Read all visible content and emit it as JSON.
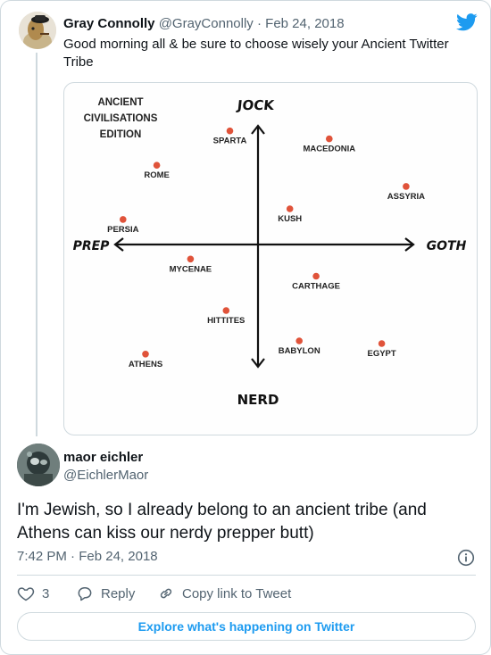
{
  "tweet1": {
    "author_name": "Gray Connolly",
    "handle": "@GrayConnolly",
    "separator": "·",
    "date": "Feb 24, 2018",
    "text": "Good morning all & be sure to choose wisely your Ancient Twitter Tribe"
  },
  "chart_data": {
    "type": "scatter",
    "title": "ANCIENT CIVILISATIONS EDITION",
    "title_lines": [
      "ANCIENT",
      "CIVILISATIONS",
      "EDITION"
    ],
    "axes": {
      "top": "JOCK",
      "bottom": "NERD",
      "left": "PREP",
      "right": "GOTH"
    },
    "xlim": [
      -10,
      10
    ],
    "ylim": [
      -10,
      10
    ],
    "grid": false,
    "points": [
      {
        "label": "SPARTA",
        "x": -1.5,
        "y": 8.6
      },
      {
        "label": "MACEDONIA",
        "x": 3.8,
        "y": 8.0
      },
      {
        "label": "ROME",
        "x": -5.4,
        "y": 6.0
      },
      {
        "label": "ASSYRIA",
        "x": 7.9,
        "y": 4.4
      },
      {
        "label": "KUSH",
        "x": 1.7,
        "y": 2.7
      },
      {
        "label": "PERSIA",
        "x": -7.2,
        "y": 1.9
      },
      {
        "label": "MYCENAE",
        "x": -3.6,
        "y": -1.1
      },
      {
        "label": "CARTHAGE",
        "x": 3.1,
        "y": -2.4
      },
      {
        "label": "HITTITES",
        "x": -1.7,
        "y": -5.0
      },
      {
        "label": "BABYLON",
        "x": 2.2,
        "y": -7.3
      },
      {
        "label": "EGYPT",
        "x": 6.6,
        "y": -7.5
      },
      {
        "label": "ATHENS",
        "x": -6.0,
        "y": -8.3
      }
    ],
    "point_color": "#e0533a"
  },
  "tweet2": {
    "author_name": "maor eichler",
    "handle": "@EichlerMaor",
    "text": "I'm Jewish, so I already belong to an ancient tribe (and Athens can kiss our nerdy prepper butt)",
    "time": "7:42 PM",
    "separator": "·",
    "date": "Feb 24, 2018"
  },
  "actions": {
    "like_count": "3",
    "reply_label": "Reply",
    "copy_link_label": "Copy link to Tweet"
  },
  "footer": {
    "explore_label": "Explore what's happening on Twitter"
  },
  "colors": {
    "twitter_blue": "#1d9bf0",
    "muted_text": "#536471",
    "border": "#cfd9de"
  },
  "icons": {
    "brand": "twitter-bird-icon",
    "info": "info-icon",
    "like": "heart-icon",
    "reply": "reply-bubble-icon",
    "copy": "link-icon"
  }
}
